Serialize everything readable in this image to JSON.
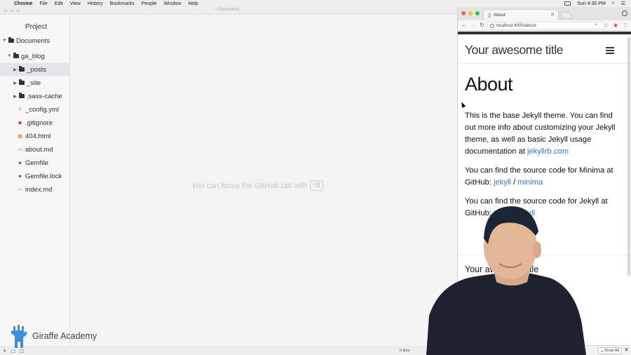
{
  "menubar": {
    "items": [
      "Chrome",
      "File",
      "Edit",
      "View",
      "History",
      "Bookmarks",
      "People",
      "Window",
      "Help"
    ],
    "clock": "Sun 4:30 PM"
  },
  "editor": {
    "window_title": "~/Documents",
    "tree": {
      "panel_title": "Project",
      "root": "Documents",
      "project": "ga_blog",
      "items": [
        {
          "label": "_posts",
          "kind": "folder"
        },
        {
          "label": "_site",
          "kind": "folder"
        },
        {
          "label": ".sass-cache",
          "kind": "folder"
        },
        {
          "label": "_config.yml",
          "kind": "file"
        },
        {
          "label": ".gitignore",
          "kind": "file"
        },
        {
          "label": "404.html",
          "kind": "file"
        },
        {
          "label": "about.md",
          "kind": "file"
        },
        {
          "label": "Gemfile",
          "kind": "file"
        },
        {
          "label": "Gemfile.lock",
          "kind": "file"
        },
        {
          "label": "index.md",
          "kind": "file"
        }
      ]
    },
    "hint": "You can focus the GitHub tab with",
    "hint_key": "^8",
    "status": {
      "files": "0 files"
    }
  },
  "logo": {
    "name": "Giraffe Academy"
  },
  "browser": {
    "tab_title": "About",
    "url": "localhost:4000/about/",
    "page": {
      "site_title": "Your awesome title",
      "heading": "About",
      "p1_text": "This is the base Jekyll theme. You can find out more info about customizing your Jekyll theme, as well as basic Jekyll usage documentation at",
      "p1_link": "jekyllrb.com",
      "p2_text": "You can find the source code for Minima at GitHub:",
      "p2_link1": "jekyll",
      "p2_sep": "/",
      "p2_link2": "minima",
      "p3_text": "You can find the source code for Jekyll at GitHub:",
      "p3_link1": "jekyll",
      "p3_sep": "/",
      "p3_link2": "jekyll",
      "footer_title": "Your awesome title"
    },
    "downloads": {
      "show_all": "Show All"
    }
  },
  "colors": {
    "link": "#2a7ae2",
    "selected_row": "#e3e4e8",
    "light_red": "#ff5f57",
    "light_yellow": "#febc2e",
    "light_green": "#28c840",
    "logo_blue": "#3a8fd6"
  }
}
